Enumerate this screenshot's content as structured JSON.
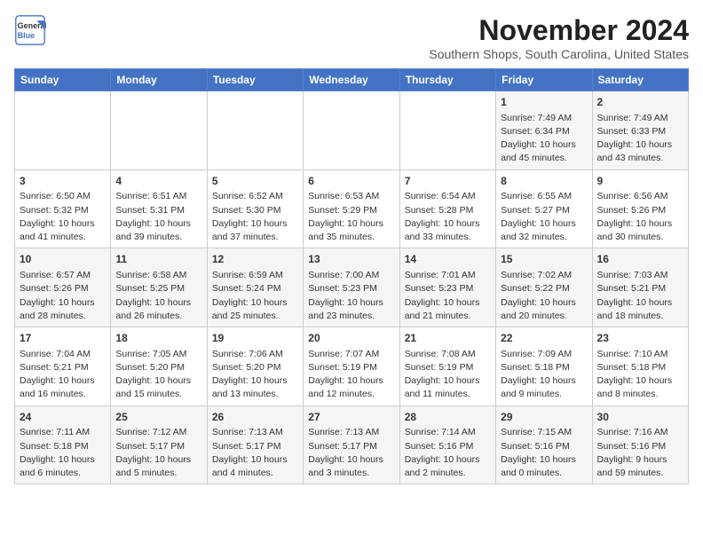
{
  "header": {
    "logo_line1": "General",
    "logo_line2": "Blue",
    "month_title": "November 2024",
    "subtitle": "Southern Shops, South Carolina, United States"
  },
  "weekdays": [
    "Sunday",
    "Monday",
    "Tuesday",
    "Wednesday",
    "Thursday",
    "Friday",
    "Saturday"
  ],
  "weeks": [
    [
      {
        "day": "",
        "info": ""
      },
      {
        "day": "",
        "info": ""
      },
      {
        "day": "",
        "info": ""
      },
      {
        "day": "",
        "info": ""
      },
      {
        "day": "",
        "info": ""
      },
      {
        "day": "1",
        "info": "Sunrise: 7:49 AM\nSunset: 6:34 PM\nDaylight: 10 hours\nand 45 minutes."
      },
      {
        "day": "2",
        "info": "Sunrise: 7:49 AM\nSunset: 6:33 PM\nDaylight: 10 hours\nand 43 minutes."
      }
    ],
    [
      {
        "day": "3",
        "info": "Sunrise: 6:50 AM\nSunset: 5:32 PM\nDaylight: 10 hours\nand 41 minutes."
      },
      {
        "day": "4",
        "info": "Sunrise: 6:51 AM\nSunset: 5:31 PM\nDaylight: 10 hours\nand 39 minutes."
      },
      {
        "day": "5",
        "info": "Sunrise: 6:52 AM\nSunset: 5:30 PM\nDaylight: 10 hours\nand 37 minutes."
      },
      {
        "day": "6",
        "info": "Sunrise: 6:53 AM\nSunset: 5:29 PM\nDaylight: 10 hours\nand 35 minutes."
      },
      {
        "day": "7",
        "info": "Sunrise: 6:54 AM\nSunset: 5:28 PM\nDaylight: 10 hours\nand 33 minutes."
      },
      {
        "day": "8",
        "info": "Sunrise: 6:55 AM\nSunset: 5:27 PM\nDaylight: 10 hours\nand 32 minutes."
      },
      {
        "day": "9",
        "info": "Sunrise: 6:56 AM\nSunset: 5:26 PM\nDaylight: 10 hours\nand 30 minutes."
      }
    ],
    [
      {
        "day": "10",
        "info": "Sunrise: 6:57 AM\nSunset: 5:26 PM\nDaylight: 10 hours\nand 28 minutes."
      },
      {
        "day": "11",
        "info": "Sunrise: 6:58 AM\nSunset: 5:25 PM\nDaylight: 10 hours\nand 26 minutes."
      },
      {
        "day": "12",
        "info": "Sunrise: 6:59 AM\nSunset: 5:24 PM\nDaylight: 10 hours\nand 25 minutes."
      },
      {
        "day": "13",
        "info": "Sunrise: 7:00 AM\nSunset: 5:23 PM\nDaylight: 10 hours\nand 23 minutes."
      },
      {
        "day": "14",
        "info": "Sunrise: 7:01 AM\nSunset: 5:23 PM\nDaylight: 10 hours\nand 21 minutes."
      },
      {
        "day": "15",
        "info": "Sunrise: 7:02 AM\nSunset: 5:22 PM\nDaylight: 10 hours\nand 20 minutes."
      },
      {
        "day": "16",
        "info": "Sunrise: 7:03 AM\nSunset: 5:21 PM\nDaylight: 10 hours\nand 18 minutes."
      }
    ],
    [
      {
        "day": "17",
        "info": "Sunrise: 7:04 AM\nSunset: 5:21 PM\nDaylight: 10 hours\nand 16 minutes."
      },
      {
        "day": "18",
        "info": "Sunrise: 7:05 AM\nSunset: 5:20 PM\nDaylight: 10 hours\nand 15 minutes."
      },
      {
        "day": "19",
        "info": "Sunrise: 7:06 AM\nSunset: 5:20 PM\nDaylight: 10 hours\nand 13 minutes."
      },
      {
        "day": "20",
        "info": "Sunrise: 7:07 AM\nSunset: 5:19 PM\nDaylight: 10 hours\nand 12 minutes."
      },
      {
        "day": "21",
        "info": "Sunrise: 7:08 AM\nSunset: 5:19 PM\nDaylight: 10 hours\nand 11 minutes."
      },
      {
        "day": "22",
        "info": "Sunrise: 7:09 AM\nSunset: 5:18 PM\nDaylight: 10 hours\nand 9 minutes."
      },
      {
        "day": "23",
        "info": "Sunrise: 7:10 AM\nSunset: 5:18 PM\nDaylight: 10 hours\nand 8 minutes."
      }
    ],
    [
      {
        "day": "24",
        "info": "Sunrise: 7:11 AM\nSunset: 5:18 PM\nDaylight: 10 hours\nand 6 minutes."
      },
      {
        "day": "25",
        "info": "Sunrise: 7:12 AM\nSunset: 5:17 PM\nDaylight: 10 hours\nand 5 minutes."
      },
      {
        "day": "26",
        "info": "Sunrise: 7:13 AM\nSunset: 5:17 PM\nDaylight: 10 hours\nand 4 minutes."
      },
      {
        "day": "27",
        "info": "Sunrise: 7:13 AM\nSunset: 5:17 PM\nDaylight: 10 hours\nand 3 minutes."
      },
      {
        "day": "28",
        "info": "Sunrise: 7:14 AM\nSunset: 5:16 PM\nDaylight: 10 hours\nand 2 minutes."
      },
      {
        "day": "29",
        "info": "Sunrise: 7:15 AM\nSunset: 5:16 PM\nDaylight: 10 hours\nand 0 minutes."
      },
      {
        "day": "30",
        "info": "Sunrise: 7:16 AM\nSunset: 5:16 PM\nDaylight: 9 hours\nand 59 minutes."
      }
    ]
  ]
}
